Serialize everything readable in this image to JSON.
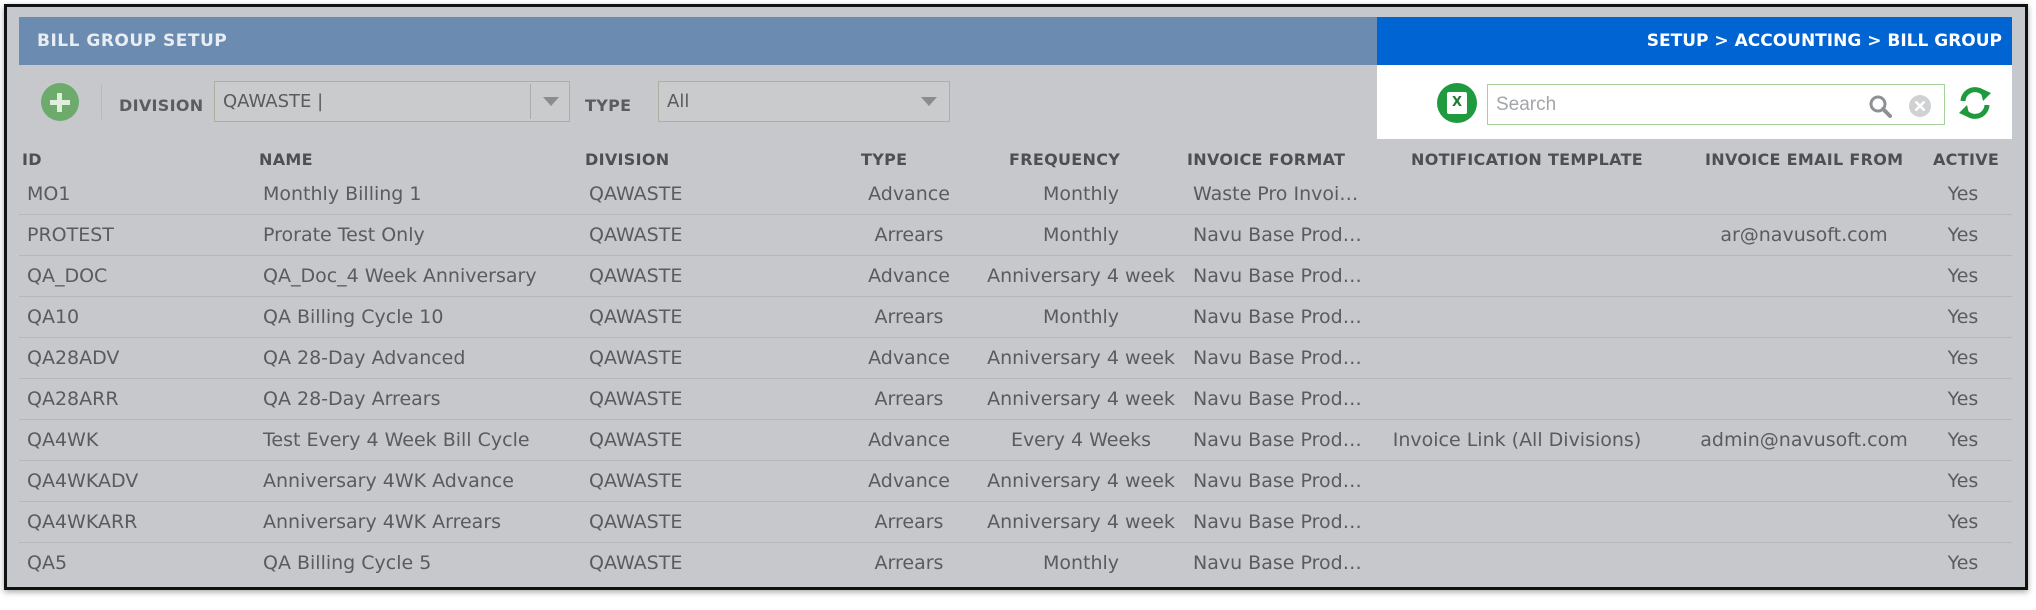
{
  "window": {
    "title": "BILL GROUP SETUP",
    "breadcrumb": "SETUP > ACCOUNTING > BILL GROUP"
  },
  "toolbar": {
    "division_label": "DIVISION",
    "division_value": "QAWASTE |",
    "type_label": "TYPE",
    "type_value": "All",
    "search_placeholder": "Search",
    "excel_icon_text": "X"
  },
  "table": {
    "columns": [
      "ID",
      "NAME",
      "DIVISION",
      "TYPE",
      "FREQUENCY",
      "INVOICE FORMAT",
      "NOTIFICATION TEMPLATE",
      "INVOICE EMAIL FROM",
      "ACTIVE"
    ],
    "rows": [
      {
        "id": "MO1",
        "name": "Monthly Billing 1",
        "division": "QAWASTE",
        "type": "Advance",
        "frequency": "Monthly",
        "invoice_format": "Waste Pro Invoi…",
        "notification_template": "",
        "invoice_email_from": "",
        "active": "Yes"
      },
      {
        "id": "PROTEST",
        "name": "Prorate Test Only",
        "division": "QAWASTE",
        "type": "Arrears",
        "frequency": "Monthly",
        "invoice_format": "Navu Base Prod…",
        "notification_template": "",
        "invoice_email_from": "ar@navusoft.com",
        "active": "Yes"
      },
      {
        "id": "QA_DOC",
        "name": "QA_Doc_4 Week Anniversary",
        "division": "QAWASTE",
        "type": "Advance",
        "frequency": "Anniversary 4 week",
        "invoice_format": "Navu Base Prod…",
        "notification_template": "",
        "invoice_email_from": "",
        "active": "Yes"
      },
      {
        "id": "QA10",
        "name": "QA Billing Cycle 10",
        "division": "QAWASTE",
        "type": "Arrears",
        "frequency": "Monthly",
        "invoice_format": "Navu Base Prod…",
        "notification_template": "",
        "invoice_email_from": "",
        "active": "Yes"
      },
      {
        "id": "QA28ADV",
        "name": "QA 28-Day Advanced",
        "division": "QAWASTE",
        "type": "Advance",
        "frequency": "Anniversary 4 week",
        "invoice_format": "Navu Base Prod…",
        "notification_template": "",
        "invoice_email_from": "",
        "active": "Yes"
      },
      {
        "id": "QA28ARR",
        "name": "QA 28-Day Arrears",
        "division": "QAWASTE",
        "type": "Arrears",
        "frequency": "Anniversary 4 week",
        "invoice_format": "Navu Base Prod…",
        "notification_template": "",
        "invoice_email_from": "",
        "active": "Yes"
      },
      {
        "id": "QA4WK",
        "name": "Test Every 4 Week Bill Cycle",
        "division": "QAWASTE",
        "type": "Advance",
        "frequency": "Every 4 Weeks",
        "invoice_format": "Navu Base Prod…",
        "notification_template": "Invoice Link (All Divisions)",
        "invoice_email_from": "admin@navusoft.com",
        "active": "Yes"
      },
      {
        "id": "QA4WKADV",
        "name": "Anniversary 4WK Advance",
        "division": "QAWASTE",
        "type": "Advance",
        "frequency": "Anniversary 4 week",
        "invoice_format": "Navu Base Prod…",
        "notification_template": "",
        "invoice_email_from": "",
        "active": "Yes"
      },
      {
        "id": "QA4WKARR",
        "name": "Anniversary 4WK Arrears",
        "division": "QAWASTE",
        "type": "Arrears",
        "frequency": "Anniversary 4 week",
        "invoice_format": "Navu Base Prod…",
        "notification_template": "",
        "invoice_email_from": "",
        "active": "Yes"
      },
      {
        "id": "QA5",
        "name": "QA Billing Cycle 5",
        "division": "QAWASTE",
        "type": "Arrears",
        "frequency": "Monthly",
        "invoice_format": "Navu Base Prod…",
        "notification_template": "",
        "invoice_email_from": "",
        "active": "Yes"
      }
    ]
  },
  "icons": {
    "add": "plus-circle-icon",
    "excel": "excel-export-icon",
    "search": "search-icon",
    "clear": "clear-icon",
    "refresh": "refresh-icon"
  },
  "colors": {
    "title_bar": "#6b8bb0",
    "breadcrumb_bar": "#0064d2",
    "accent_green": "#1f9a3e",
    "overlay_grey": "#c6c8cb"
  }
}
